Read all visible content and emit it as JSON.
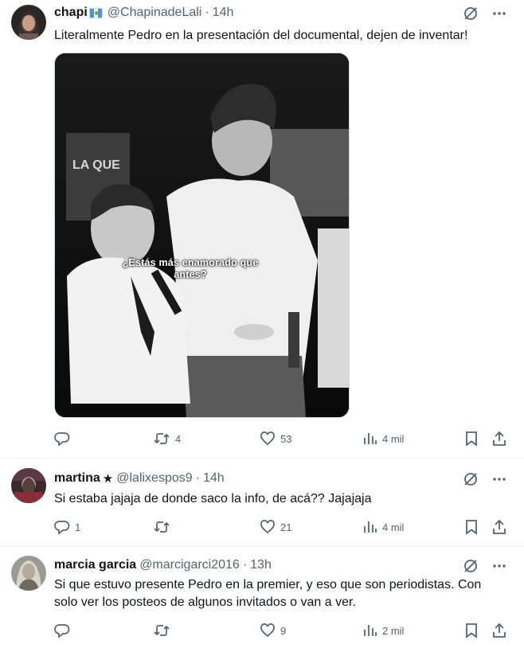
{
  "tweets": [
    {
      "name": "chapi",
      "has_flag": true,
      "handle": "@ChapinadeLali",
      "time": "14h",
      "text": "Literalmente Pedro en la presentación del documental, dejen de inventar!",
      "media_caption_line1": "¿Estás más enamorado que",
      "media_caption_line2": "antes?",
      "replies": "",
      "retweets": "4",
      "likes": "53",
      "views": "4 mil"
    },
    {
      "name": "martina",
      "star": "★",
      "handle": "@lalixespos9",
      "time": "14h",
      "text": "Si estaba jajaja de donde saco la info, de acá?? Jajajaja",
      "replies": "1",
      "retweets": "",
      "likes": "21",
      "views": "4 mil"
    },
    {
      "name": "marcia garcia",
      "handle": "@marcigarci2016",
      "time": "13h",
      "text_line1": "Si que estuvo presente Pedro en  la premier, y eso que son periodistas. Con",
      "text_line2": "solo ver los posteos de algunos invitados o van a ver.",
      "replies": "",
      "retweets": "",
      "likes": "9",
      "views": "2 mil"
    }
  ],
  "separator": "·",
  "icons": {
    "grok": "grok-slash-circle-icon",
    "more": "more-horizontal-icon",
    "reply": "reply-bubble-icon",
    "retweet": "retweet-icon",
    "like": "heart-icon",
    "views": "views-bar-chart-icon",
    "bookmark": "bookmark-icon",
    "share": "share-upload-icon"
  },
  "colors": {
    "secondary_text": "#536471",
    "divider": "#eff3f4",
    "primary_text": "#0f1419"
  }
}
